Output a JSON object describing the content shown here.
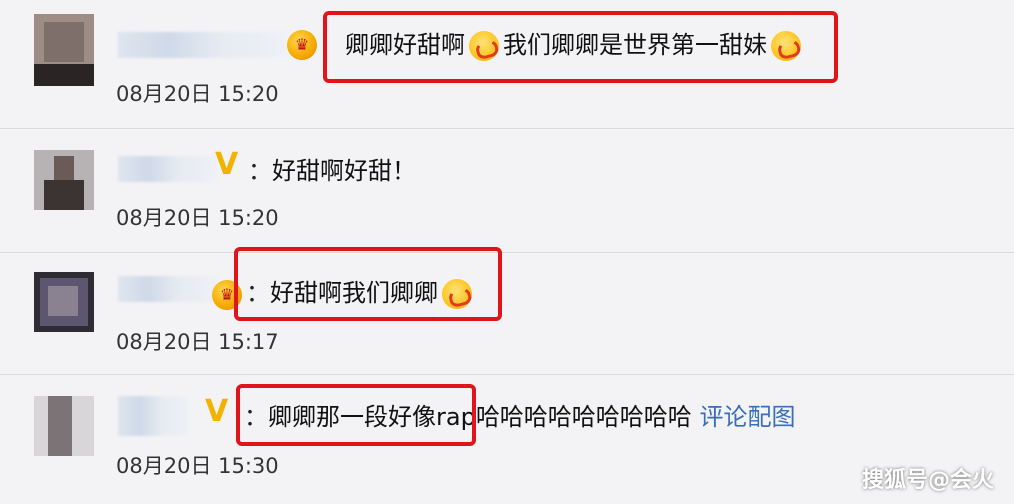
{
  "comments": [
    {
      "badge": "crown-badge",
      "segments": [
        {
          "type": "text",
          "value": "卿卿好甜啊"
        },
        {
          "type": "emoji",
          "value": "kiss-emoji"
        },
        {
          "type": "text",
          "value": "我们卿卿是世界第一甜妹"
        },
        {
          "type": "emoji",
          "value": "kiss-emoji"
        }
      ],
      "time": "08月20日 15:20",
      "highlighted": true
    },
    {
      "badge": "v-badge",
      "colon": "：",
      "text": "好甜啊好甜！",
      "time": "08月20日 15:20",
      "highlighted": false
    },
    {
      "badge": "crown-badge",
      "colon": "：",
      "text": "好甜啊我们卿卿",
      "emoji": "kiss-emoji",
      "time": "08月20日 15:17",
      "highlighted": true
    },
    {
      "badge": "v-badge",
      "colon": "：",
      "text_highlighted": "卿卿那一段好像rap",
      "text_rest": "哈哈哈哈哈哈哈哈哈",
      "link": "评论配图",
      "time": "08月20日 15:30",
      "highlighted": true
    }
  ],
  "watermark": "搜狐号@会火",
  "colors": {
    "highlight": "#e0141b",
    "link": "#3a6fb7",
    "background": "#f3f3f5"
  }
}
